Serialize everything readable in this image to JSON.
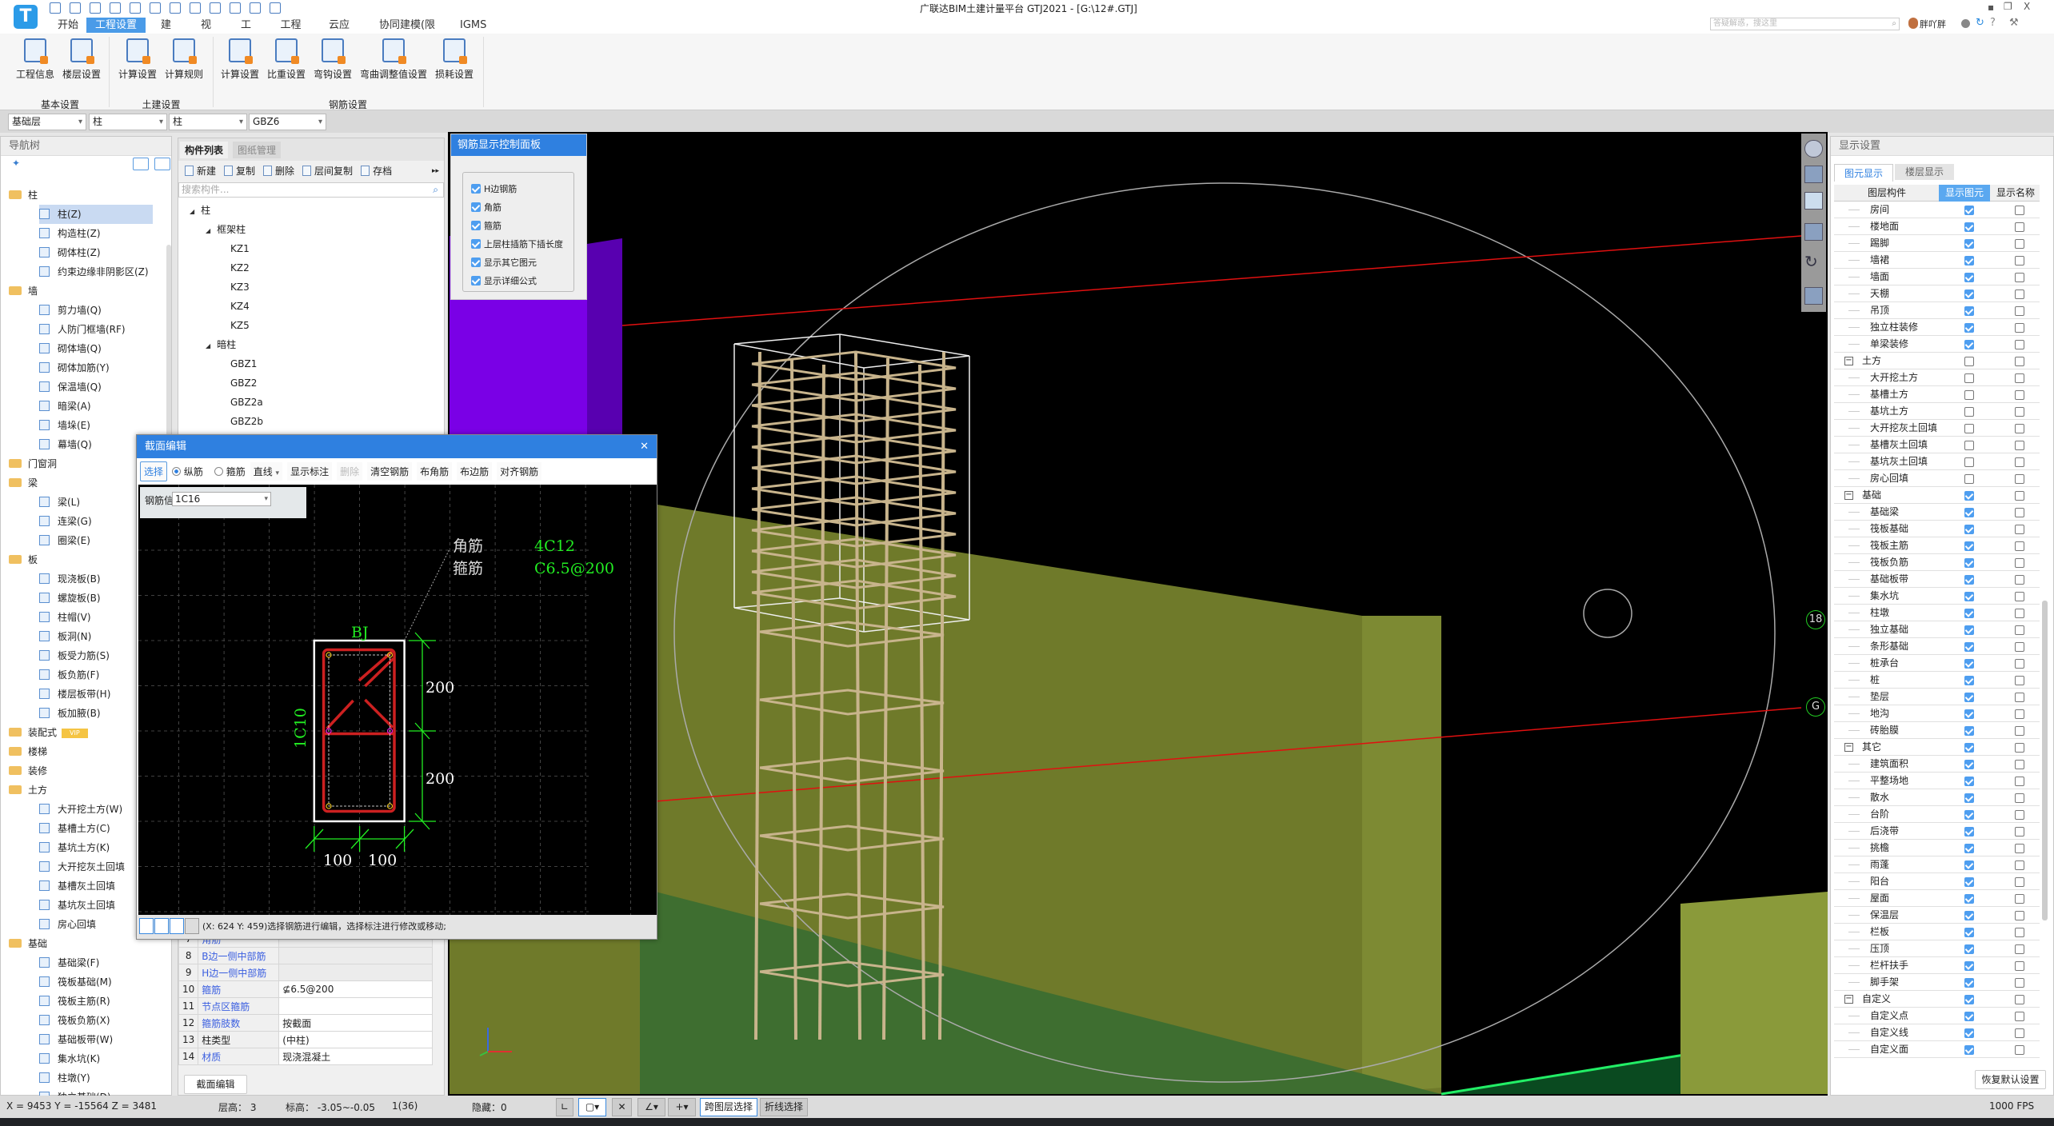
{
  "app": {
    "title": "广联达BIM土建计量平台 GTJ2021 - [G:\\12#.GTJ]",
    "logo_letter": "T",
    "search_placeholder": "答疑解惑，搜这里",
    "user": "胖吖胖",
    "window_controls": [
      "minimize-icon",
      "restore-icon",
      "close-icon"
    ]
  },
  "menu_tabs": [
    {
      "label": "开始"
    },
    {
      "label": "工程设置",
      "selected": true
    },
    {
      "label": "建模"
    },
    {
      "label": "视图"
    },
    {
      "label": "工具"
    },
    {
      "label": "工程量"
    },
    {
      "label": "云应用"
    },
    {
      "label": "协同建模(限免)"
    },
    {
      "label": "IGMS"
    }
  ],
  "ribbon": {
    "groups": [
      {
        "label": "基本设置",
        "buttons": [
          "工程信息",
          "楼层设置"
        ]
      },
      {
        "label": "土建设置",
        "buttons": [
          "计算设置",
          "计算规则"
        ]
      },
      {
        "label": "钢筋设置",
        "buttons": [
          "计算设置",
          "比重设置",
          "弯钩设置",
          "弯曲调整值设置",
          "损耗设置"
        ]
      }
    ]
  },
  "selectors": [
    "基础层",
    "柱",
    "柱",
    "GBZ6"
  ],
  "nav": {
    "title": "导航树",
    "items": [
      {
        "label": "柱",
        "group": true,
        "open": true
      },
      {
        "label": "柱(Z)",
        "selected": true
      },
      {
        "label": "构造柱(Z)"
      },
      {
        "label": "砌体柱(Z)"
      },
      {
        "label": "约束边缘非阴影区(Z)"
      },
      {
        "label": "墙",
        "group": true,
        "open": true
      },
      {
        "label": "剪力墙(Q)"
      },
      {
        "label": "人防门框墙(RF)"
      },
      {
        "label": "砌体墙(Q)"
      },
      {
        "label": "砌体加筋(Y)"
      },
      {
        "label": "保温墙(Q)"
      },
      {
        "label": "暗梁(A)"
      },
      {
        "label": "墙垛(E)"
      },
      {
        "label": "幕墙(Q)"
      },
      {
        "label": "门窗洞",
        "group": true
      },
      {
        "label": "梁",
        "group": true,
        "open": true
      },
      {
        "label": "梁(L)"
      },
      {
        "label": "连梁(G)"
      },
      {
        "label": "圈梁(E)"
      },
      {
        "label": "板",
        "group": true,
        "open": true
      },
      {
        "label": "现浇板(B)"
      },
      {
        "label": "螺旋板(B)"
      },
      {
        "label": "柱帽(V)"
      },
      {
        "label": "板洞(N)"
      },
      {
        "label": "板受力筋(S)"
      },
      {
        "label": "板负筋(F)"
      },
      {
        "label": "楼层板带(H)"
      },
      {
        "label": "板加腋(B)"
      },
      {
        "label": "装配式",
        "group": true,
        "badge": "VIP"
      },
      {
        "label": "楼梯",
        "group": true
      },
      {
        "label": "装修",
        "group": true
      },
      {
        "label": "土方",
        "group": true,
        "open": true
      },
      {
        "label": "大开挖土方(W)"
      },
      {
        "label": "基槽土方(C)"
      },
      {
        "label": "基坑土方(K)"
      },
      {
        "label": "大开挖灰土回填"
      },
      {
        "label": "基槽灰土回填"
      },
      {
        "label": "基坑灰土回填"
      },
      {
        "label": "房心回填"
      },
      {
        "label": "基础",
        "group": true,
        "open": true
      },
      {
        "label": "基础梁(F)"
      },
      {
        "label": "筏板基础(M)"
      },
      {
        "label": "筏板主筋(R)"
      },
      {
        "label": "筏板负筋(X)"
      },
      {
        "label": "基础板带(W)"
      },
      {
        "label": "集水坑(K)"
      },
      {
        "label": "柱墩(Y)"
      },
      {
        "label": "独立基础(D)"
      }
    ]
  },
  "component_list": {
    "tabs": [
      "构件列表",
      "图纸管理"
    ],
    "toolbar": [
      "新建",
      "复制",
      "删除",
      "层间复制",
      "存档"
    ],
    "search_placeholder": "搜索构件...",
    "tree": [
      {
        "label": "柱",
        "level": 0
      },
      {
        "label": "框架柱",
        "level": 1
      },
      {
        "label": "KZ1",
        "level": 2
      },
      {
        "label": "KZ2",
        "level": 2
      },
      {
        "label": "KZ3",
        "level": 2
      },
      {
        "label": "KZ4",
        "level": 2
      },
      {
        "label": "KZ5",
        "level": 2
      },
      {
        "label": "暗柱",
        "level": 1
      },
      {
        "label": "GBZ1",
        "level": 2
      },
      {
        "label": "GBZ2",
        "level": 2
      },
      {
        "label": "GBZ2a",
        "level": 2
      },
      {
        "label": "GBZ2b",
        "level": 2
      }
    ]
  },
  "properties": {
    "rows": [
      {
        "no": "7",
        "name": "角筋",
        "value": "",
        "blue": true,
        "gray": true
      },
      {
        "no": "8",
        "name": "B边一侧中部筋",
        "value": "",
        "blue": true,
        "gray": true
      },
      {
        "no": "9",
        "name": "H边一侧中部筋",
        "value": "",
        "blue": true,
        "gray": true
      },
      {
        "no": "10",
        "name": "箍筋",
        "value": "⊈6.5@200",
        "blue": true
      },
      {
        "no": "11",
        "name": "节点区箍筋",
        "value": "",
        "blue": true
      },
      {
        "no": "12",
        "name": "箍筋肢数",
        "value": "按截面",
        "blue": true
      },
      {
        "no": "13",
        "name": "柱类型",
        "value": "(中柱)",
        "blue": false
      },
      {
        "no": "14",
        "name": "材质",
        "value": "现浇混凝土",
        "blue": true
      }
    ],
    "section_edit_button": "截面编辑"
  },
  "rebar_panel": {
    "title": "钢筋显示控制面板",
    "options": [
      {
        "label": "H边钢筋",
        "checked": true
      },
      {
        "label": "角筋",
        "checked": true
      },
      {
        "label": "箍筋",
        "checked": true
      },
      {
        "label": "上层柱插筋下插长度",
        "checked": true
      },
      {
        "label": "显示其它图元",
        "checked": true
      },
      {
        "label": "显示详细公式",
        "checked": true
      }
    ]
  },
  "section_dialog": {
    "title": "截面编辑",
    "toolbar": {
      "select": "选择",
      "radio_long": "纵筋",
      "radio_stirrup": "箍筋",
      "radio_selected": "纵筋",
      "line_mode": "直线",
      "show_dim": "显示标注",
      "delete": "删除",
      "clear": "清空钢筋",
      "corner": "布角筋",
      "side": "布边筋",
      "align": "对齐钢筋"
    },
    "rebar_info_label": "钢筋信息:",
    "rebar_info_value": "1C16",
    "drawing": {
      "name": "BJ",
      "side_bar": "1C10",
      "corner_label": "角筋",
      "corner_value": "4C12",
      "stirrup_label": "箍筋",
      "stirrup_value": "C6.5@200",
      "dims_h": [
        "200",
        "200"
      ],
      "dims_w": [
        "100",
        "100"
      ]
    },
    "status": "(X: 624 Y: 459)选择钢筋进行编辑，选择标注进行修改或移动;"
  },
  "viewport": {
    "axis_labels": [
      "18",
      "G"
    ],
    "colors": {
      "background": "#000000",
      "wall": "#7a00e6",
      "earth": "#6f7a2a",
      "rebar": "#c8b48c",
      "axis": "#e01010"
    }
  },
  "display_settings": {
    "title": "显示设置",
    "tabs": [
      "图元显示",
      "楼层显示"
    ],
    "headers": [
      "图层构件",
      "显示图元",
      "显示名称"
    ],
    "rows": [
      {
        "label": "房间",
        "show": true,
        "name": false
      },
      {
        "label": "楼地面",
        "show": true,
        "name": false
      },
      {
        "label": "踢脚",
        "show": true,
        "name": false
      },
      {
        "label": "墙裙",
        "show": true,
        "name": false
      },
      {
        "label": "墙面",
        "show": true,
        "name": false
      },
      {
        "label": "天棚",
        "show": true,
        "name": false
      },
      {
        "label": "吊顶",
        "show": true,
        "name": false
      },
      {
        "label": "独立柱装修",
        "show": true,
        "name": false
      },
      {
        "label": "单梁装修",
        "show": true,
        "name": false
      },
      {
        "label": "土方",
        "group": true,
        "show": false,
        "name": false
      },
      {
        "label": "大开挖土方",
        "show": false,
        "name": false
      },
      {
        "label": "基槽土方",
        "show": false,
        "name": false
      },
      {
        "label": "基坑土方",
        "show": false,
        "name": false
      },
      {
        "label": "大开挖灰土回填",
        "show": false,
        "name": false
      },
      {
        "label": "基槽灰土回填",
        "show": false,
        "name": false
      },
      {
        "label": "基坑灰土回填",
        "show": false,
        "name": false
      },
      {
        "label": "房心回填",
        "show": false,
        "name": false
      },
      {
        "label": "基础",
        "group": true,
        "show": true,
        "name": false
      },
      {
        "label": "基础梁",
        "show": true,
        "name": false
      },
      {
        "label": "筏板基础",
        "show": true,
        "name": false
      },
      {
        "label": "筏板主筋",
        "show": true,
        "name": false
      },
      {
        "label": "筏板负筋",
        "show": true,
        "name": false
      },
      {
        "label": "基础板带",
        "show": true,
        "name": false
      },
      {
        "label": "集水坑",
        "show": true,
        "name": false
      },
      {
        "label": "柱墩",
        "show": true,
        "name": false
      },
      {
        "label": "独立基础",
        "show": true,
        "name": false
      },
      {
        "label": "条形基础",
        "show": true,
        "name": false
      },
      {
        "label": "桩承台",
        "show": true,
        "name": false
      },
      {
        "label": "桩",
        "show": true,
        "name": false
      },
      {
        "label": "垫层",
        "show": true,
        "name": false
      },
      {
        "label": "地沟",
        "show": true,
        "name": false
      },
      {
        "label": "砖胎膜",
        "show": true,
        "name": false
      },
      {
        "label": "其它",
        "group": true,
        "show": true,
        "name": false
      },
      {
        "label": "建筑面积",
        "show": true,
        "name": false
      },
      {
        "label": "平整场地",
        "show": true,
        "name": false
      },
      {
        "label": "散水",
        "show": true,
        "name": false
      },
      {
        "label": "台阶",
        "show": true,
        "name": false
      },
      {
        "label": "后浇带",
        "show": true,
        "name": false
      },
      {
        "label": "挑檐",
        "show": true,
        "name": false
      },
      {
        "label": "雨蓬",
        "show": true,
        "name": false
      },
      {
        "label": "阳台",
        "show": true,
        "name": false
      },
      {
        "label": "屋面",
        "show": true,
        "name": false
      },
      {
        "label": "保温层",
        "show": true,
        "name": false
      },
      {
        "label": "栏板",
        "show": true,
        "name": false
      },
      {
        "label": "压顶",
        "show": true,
        "name": false
      },
      {
        "label": "栏杆扶手",
        "show": true,
        "name": false
      },
      {
        "label": "脚手架",
        "show": true,
        "name": false
      },
      {
        "label": "自定义",
        "group": true,
        "show": true,
        "name": false
      },
      {
        "label": "自定义点",
        "show": true,
        "name": false
      },
      {
        "label": "自定义线",
        "show": true,
        "name": false
      },
      {
        "label": "自定义面",
        "show": true,
        "name": false
      }
    ],
    "restore_button": "恢复默认设置"
  },
  "statusbar": {
    "coords": "X = 9453 Y = -15564 Z = 3481",
    "floor_height": "层高：  3",
    "elevation": "标高：  -3.05~-0.05",
    "count": "1(36)",
    "hidden": "隐藏：0",
    "cross_layer": "跨图层选择",
    "polyline": "折线选择",
    "fps": "1000 FPS"
  }
}
